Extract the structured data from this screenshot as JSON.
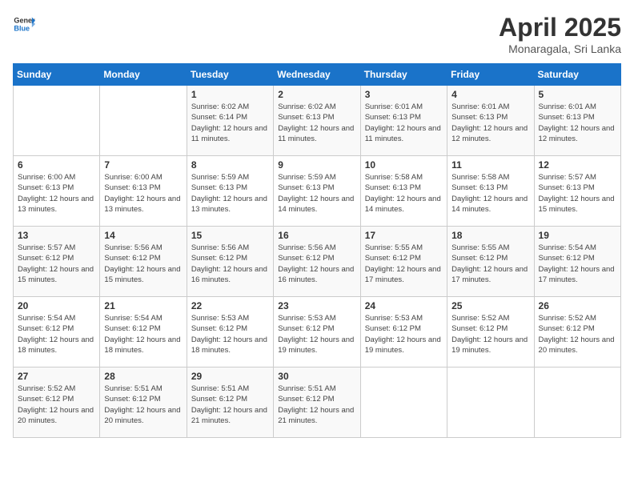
{
  "header": {
    "logo_general": "General",
    "logo_blue": "Blue",
    "title": "April 2025",
    "subtitle": "Monaragala, Sri Lanka"
  },
  "days_of_week": [
    "Sunday",
    "Monday",
    "Tuesday",
    "Wednesday",
    "Thursday",
    "Friday",
    "Saturday"
  ],
  "weeks": [
    [
      {
        "day": "",
        "info": ""
      },
      {
        "day": "",
        "info": ""
      },
      {
        "day": "1",
        "info": "Sunrise: 6:02 AM\nSunset: 6:14 PM\nDaylight: 12 hours and 11 minutes."
      },
      {
        "day": "2",
        "info": "Sunrise: 6:02 AM\nSunset: 6:13 PM\nDaylight: 12 hours and 11 minutes."
      },
      {
        "day": "3",
        "info": "Sunrise: 6:01 AM\nSunset: 6:13 PM\nDaylight: 12 hours and 11 minutes."
      },
      {
        "day": "4",
        "info": "Sunrise: 6:01 AM\nSunset: 6:13 PM\nDaylight: 12 hours and 12 minutes."
      },
      {
        "day": "5",
        "info": "Sunrise: 6:01 AM\nSunset: 6:13 PM\nDaylight: 12 hours and 12 minutes."
      }
    ],
    [
      {
        "day": "6",
        "info": "Sunrise: 6:00 AM\nSunset: 6:13 PM\nDaylight: 12 hours and 13 minutes."
      },
      {
        "day": "7",
        "info": "Sunrise: 6:00 AM\nSunset: 6:13 PM\nDaylight: 12 hours and 13 minutes."
      },
      {
        "day": "8",
        "info": "Sunrise: 5:59 AM\nSunset: 6:13 PM\nDaylight: 12 hours and 13 minutes."
      },
      {
        "day": "9",
        "info": "Sunrise: 5:59 AM\nSunset: 6:13 PM\nDaylight: 12 hours and 14 minutes."
      },
      {
        "day": "10",
        "info": "Sunrise: 5:58 AM\nSunset: 6:13 PM\nDaylight: 12 hours and 14 minutes."
      },
      {
        "day": "11",
        "info": "Sunrise: 5:58 AM\nSunset: 6:13 PM\nDaylight: 12 hours and 14 minutes."
      },
      {
        "day": "12",
        "info": "Sunrise: 5:57 AM\nSunset: 6:13 PM\nDaylight: 12 hours and 15 minutes."
      }
    ],
    [
      {
        "day": "13",
        "info": "Sunrise: 5:57 AM\nSunset: 6:12 PM\nDaylight: 12 hours and 15 minutes."
      },
      {
        "day": "14",
        "info": "Sunrise: 5:56 AM\nSunset: 6:12 PM\nDaylight: 12 hours and 15 minutes."
      },
      {
        "day": "15",
        "info": "Sunrise: 5:56 AM\nSunset: 6:12 PM\nDaylight: 12 hours and 16 minutes."
      },
      {
        "day": "16",
        "info": "Sunrise: 5:56 AM\nSunset: 6:12 PM\nDaylight: 12 hours and 16 minutes."
      },
      {
        "day": "17",
        "info": "Sunrise: 5:55 AM\nSunset: 6:12 PM\nDaylight: 12 hours and 17 minutes."
      },
      {
        "day": "18",
        "info": "Sunrise: 5:55 AM\nSunset: 6:12 PM\nDaylight: 12 hours and 17 minutes."
      },
      {
        "day": "19",
        "info": "Sunrise: 5:54 AM\nSunset: 6:12 PM\nDaylight: 12 hours and 17 minutes."
      }
    ],
    [
      {
        "day": "20",
        "info": "Sunrise: 5:54 AM\nSunset: 6:12 PM\nDaylight: 12 hours and 18 minutes."
      },
      {
        "day": "21",
        "info": "Sunrise: 5:54 AM\nSunset: 6:12 PM\nDaylight: 12 hours and 18 minutes."
      },
      {
        "day": "22",
        "info": "Sunrise: 5:53 AM\nSunset: 6:12 PM\nDaylight: 12 hours and 18 minutes."
      },
      {
        "day": "23",
        "info": "Sunrise: 5:53 AM\nSunset: 6:12 PM\nDaylight: 12 hours and 19 minutes."
      },
      {
        "day": "24",
        "info": "Sunrise: 5:53 AM\nSunset: 6:12 PM\nDaylight: 12 hours and 19 minutes."
      },
      {
        "day": "25",
        "info": "Sunrise: 5:52 AM\nSunset: 6:12 PM\nDaylight: 12 hours and 19 minutes."
      },
      {
        "day": "26",
        "info": "Sunrise: 5:52 AM\nSunset: 6:12 PM\nDaylight: 12 hours and 20 minutes."
      }
    ],
    [
      {
        "day": "27",
        "info": "Sunrise: 5:52 AM\nSunset: 6:12 PM\nDaylight: 12 hours and 20 minutes."
      },
      {
        "day": "28",
        "info": "Sunrise: 5:51 AM\nSunset: 6:12 PM\nDaylight: 12 hours and 20 minutes."
      },
      {
        "day": "29",
        "info": "Sunrise: 5:51 AM\nSunset: 6:12 PM\nDaylight: 12 hours and 21 minutes."
      },
      {
        "day": "30",
        "info": "Sunrise: 5:51 AM\nSunset: 6:12 PM\nDaylight: 12 hours and 21 minutes."
      },
      {
        "day": "",
        "info": ""
      },
      {
        "day": "",
        "info": ""
      },
      {
        "day": "",
        "info": ""
      }
    ]
  ]
}
